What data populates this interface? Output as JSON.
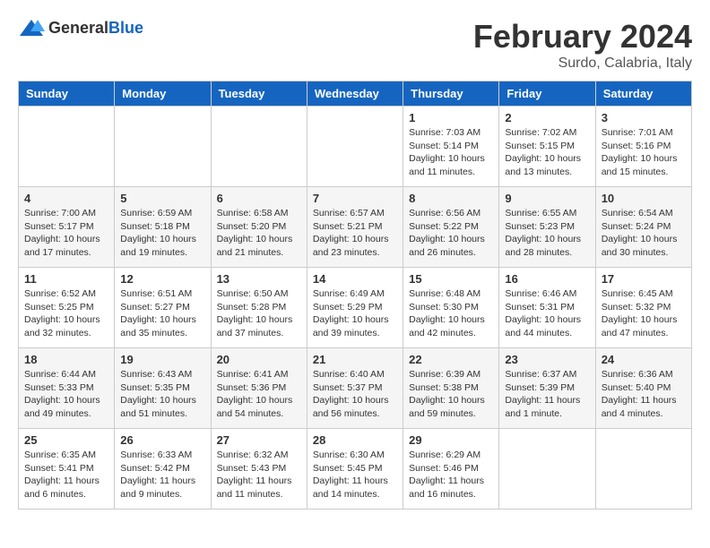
{
  "header": {
    "logo_general": "General",
    "logo_blue": "Blue",
    "month_title": "February 2024",
    "location": "Surdo, Calabria, Italy"
  },
  "days_of_week": [
    "Sunday",
    "Monday",
    "Tuesday",
    "Wednesday",
    "Thursday",
    "Friday",
    "Saturday"
  ],
  "weeks": [
    [
      {
        "day": "",
        "info": ""
      },
      {
        "day": "",
        "info": ""
      },
      {
        "day": "",
        "info": ""
      },
      {
        "day": "",
        "info": ""
      },
      {
        "day": "1",
        "info": "Sunrise: 7:03 AM\nSunset: 5:14 PM\nDaylight: 10 hours\nand 11 minutes."
      },
      {
        "day": "2",
        "info": "Sunrise: 7:02 AM\nSunset: 5:15 PM\nDaylight: 10 hours\nand 13 minutes."
      },
      {
        "day": "3",
        "info": "Sunrise: 7:01 AM\nSunset: 5:16 PM\nDaylight: 10 hours\nand 15 minutes."
      }
    ],
    [
      {
        "day": "4",
        "info": "Sunrise: 7:00 AM\nSunset: 5:17 PM\nDaylight: 10 hours\nand 17 minutes."
      },
      {
        "day": "5",
        "info": "Sunrise: 6:59 AM\nSunset: 5:18 PM\nDaylight: 10 hours\nand 19 minutes."
      },
      {
        "day": "6",
        "info": "Sunrise: 6:58 AM\nSunset: 5:20 PM\nDaylight: 10 hours\nand 21 minutes."
      },
      {
        "day": "7",
        "info": "Sunrise: 6:57 AM\nSunset: 5:21 PM\nDaylight: 10 hours\nand 23 minutes."
      },
      {
        "day": "8",
        "info": "Sunrise: 6:56 AM\nSunset: 5:22 PM\nDaylight: 10 hours\nand 26 minutes."
      },
      {
        "day": "9",
        "info": "Sunrise: 6:55 AM\nSunset: 5:23 PM\nDaylight: 10 hours\nand 28 minutes."
      },
      {
        "day": "10",
        "info": "Sunrise: 6:54 AM\nSunset: 5:24 PM\nDaylight: 10 hours\nand 30 minutes."
      }
    ],
    [
      {
        "day": "11",
        "info": "Sunrise: 6:52 AM\nSunset: 5:25 PM\nDaylight: 10 hours\nand 32 minutes."
      },
      {
        "day": "12",
        "info": "Sunrise: 6:51 AM\nSunset: 5:27 PM\nDaylight: 10 hours\nand 35 minutes."
      },
      {
        "day": "13",
        "info": "Sunrise: 6:50 AM\nSunset: 5:28 PM\nDaylight: 10 hours\nand 37 minutes."
      },
      {
        "day": "14",
        "info": "Sunrise: 6:49 AM\nSunset: 5:29 PM\nDaylight: 10 hours\nand 39 minutes."
      },
      {
        "day": "15",
        "info": "Sunrise: 6:48 AM\nSunset: 5:30 PM\nDaylight: 10 hours\nand 42 minutes."
      },
      {
        "day": "16",
        "info": "Sunrise: 6:46 AM\nSunset: 5:31 PM\nDaylight: 10 hours\nand 44 minutes."
      },
      {
        "day": "17",
        "info": "Sunrise: 6:45 AM\nSunset: 5:32 PM\nDaylight: 10 hours\nand 47 minutes."
      }
    ],
    [
      {
        "day": "18",
        "info": "Sunrise: 6:44 AM\nSunset: 5:33 PM\nDaylight: 10 hours\nand 49 minutes."
      },
      {
        "day": "19",
        "info": "Sunrise: 6:43 AM\nSunset: 5:35 PM\nDaylight: 10 hours\nand 51 minutes."
      },
      {
        "day": "20",
        "info": "Sunrise: 6:41 AM\nSunset: 5:36 PM\nDaylight: 10 hours\nand 54 minutes."
      },
      {
        "day": "21",
        "info": "Sunrise: 6:40 AM\nSunset: 5:37 PM\nDaylight: 10 hours\nand 56 minutes."
      },
      {
        "day": "22",
        "info": "Sunrise: 6:39 AM\nSunset: 5:38 PM\nDaylight: 10 hours\nand 59 minutes."
      },
      {
        "day": "23",
        "info": "Sunrise: 6:37 AM\nSunset: 5:39 PM\nDaylight: 11 hours\nand 1 minute."
      },
      {
        "day": "24",
        "info": "Sunrise: 6:36 AM\nSunset: 5:40 PM\nDaylight: 11 hours\nand 4 minutes."
      }
    ],
    [
      {
        "day": "25",
        "info": "Sunrise: 6:35 AM\nSunset: 5:41 PM\nDaylight: 11 hours\nand 6 minutes."
      },
      {
        "day": "26",
        "info": "Sunrise: 6:33 AM\nSunset: 5:42 PM\nDaylight: 11 hours\nand 9 minutes."
      },
      {
        "day": "27",
        "info": "Sunrise: 6:32 AM\nSunset: 5:43 PM\nDaylight: 11 hours\nand 11 minutes."
      },
      {
        "day": "28",
        "info": "Sunrise: 6:30 AM\nSunset: 5:45 PM\nDaylight: 11 hours\nand 14 minutes."
      },
      {
        "day": "29",
        "info": "Sunrise: 6:29 AM\nSunset: 5:46 PM\nDaylight: 11 hours\nand 16 minutes."
      },
      {
        "day": "",
        "info": ""
      },
      {
        "day": "",
        "info": ""
      }
    ]
  ]
}
